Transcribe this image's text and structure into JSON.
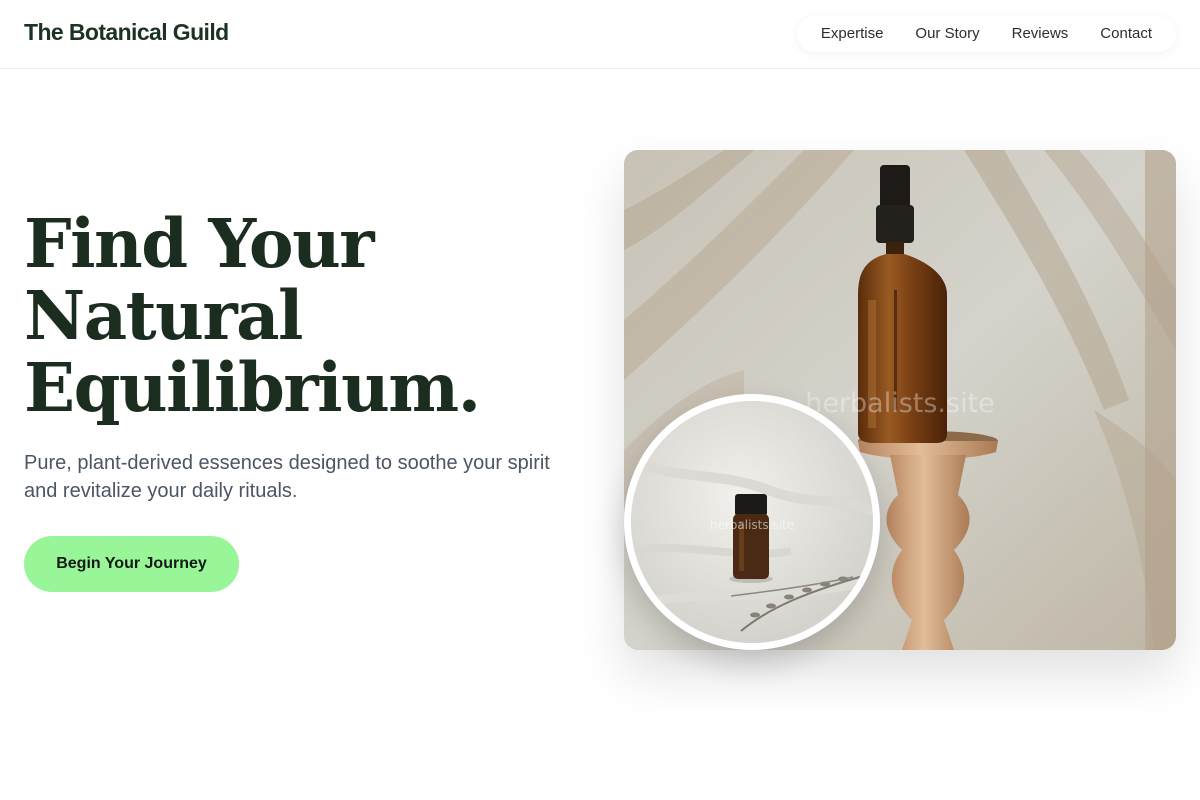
{
  "header": {
    "brand": "The Botanical Guild",
    "nav": [
      {
        "label": "Expertise"
      },
      {
        "label": "Our Story"
      },
      {
        "label": "Reviews"
      },
      {
        "label": "Contact"
      }
    ]
  },
  "hero": {
    "title_lines": [
      "Find Your",
      "Natural",
      "Equilibrium."
    ],
    "subtitle": "Pure, plant-derived essences designed to soothe your spirit and revitalize your daily rituals.",
    "cta_label": "Begin Your Journey"
  },
  "media": {
    "main_watermark": "herbalists.site",
    "inset_watermark": "herbalists.site"
  },
  "colors": {
    "brand_text": "#1c3324",
    "cta_background": "#98f598",
    "subtitle_text": "#4b5563"
  }
}
